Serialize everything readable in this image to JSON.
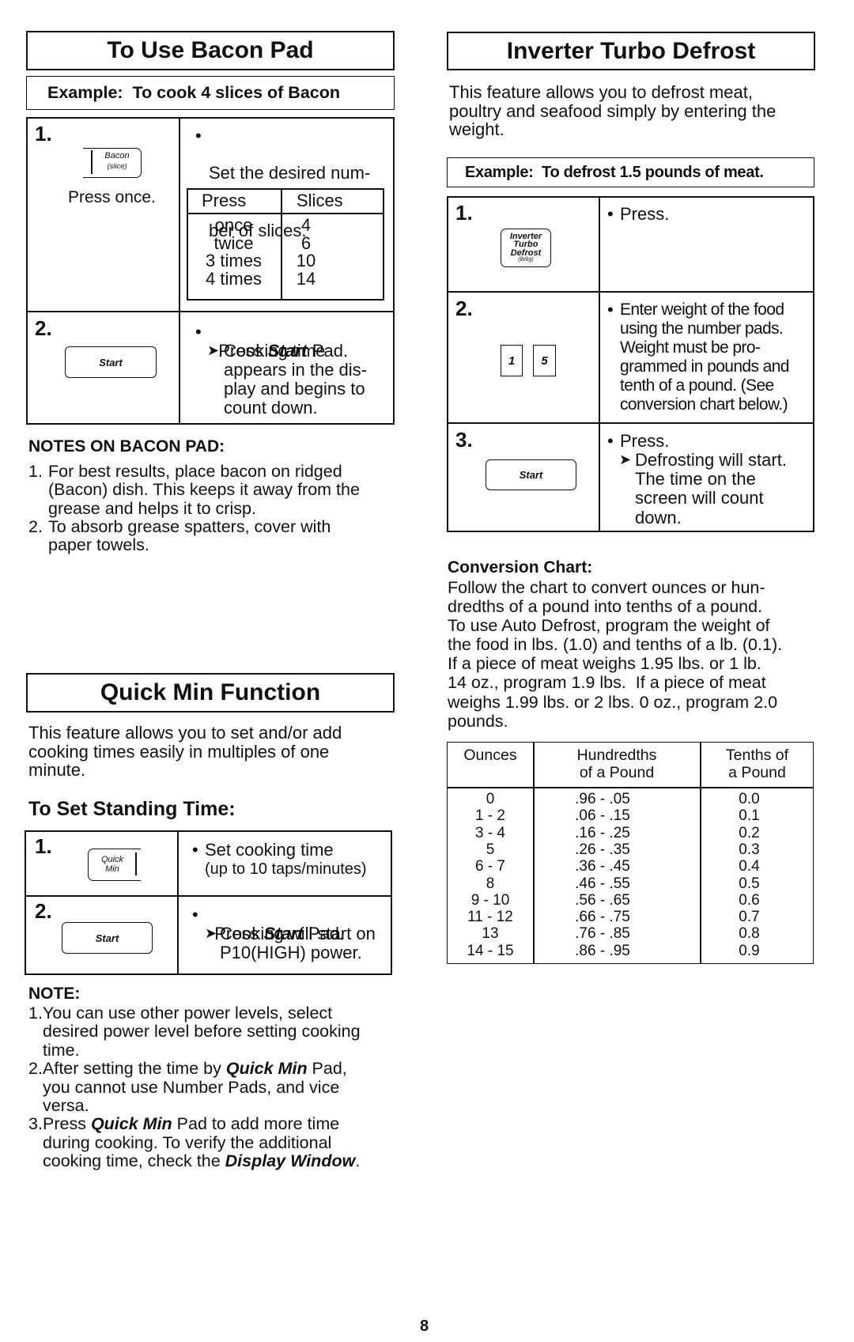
{
  "bacon": {
    "title": "To Use Bacon Pad",
    "example": "Example:  To cook 4 slices of Bacon",
    "steps": [
      {
        "number": "1.",
        "pad_label_1": "Bacon",
        "pad_label_2": "(slice)",
        "pad_caption": "Press once.",
        "instruction_line_1": "Set the desired num-",
        "instruction_line_2": "ber of slices.",
        "table": {
          "headers": [
            "Press",
            "Slices"
          ],
          "rows": [
            [
              "once",
              "4"
            ],
            [
              "twice",
              "6"
            ],
            [
              "3 times",
              "10"
            ],
            [
              "4 times",
              "14"
            ]
          ]
        }
      },
      {
        "number": "2.",
        "pad_label": "Start",
        "instruction_pre": "Press ",
        "instruction_emph": "Start",
        "instruction_post": " Pad.",
        "result_lines": [
          "Cooking time",
          "appears in the dis-",
          "play and begins to",
          "count down."
        ]
      }
    ],
    "notes_heading": "NOTES ON BACON PAD:",
    "notes": [
      {
        "num": "1.",
        "lines": [
          "For best results, place bacon on ridged",
          "(Bacon) dish. This keeps it away from the",
          "grease and helps it to crisp."
        ]
      },
      {
        "num": "2.",
        "lines": [
          "To absorb grease spatters, cover with",
          "paper towels."
        ]
      }
    ]
  },
  "quick_min": {
    "title": "Quick Min Function",
    "intro_lines": [
      "This feature allows you to set and/or add",
      "cooking times easily in multiples of one",
      "minute."
    ],
    "subheading": "To Set Standing Time:",
    "steps": [
      {
        "number": "1.",
        "pad_label_1": "Quick",
        "pad_label_2": "Min",
        "instruction_line_1": "Set cooking time",
        "instruction_line_2": "(up to 10 taps/minutes)"
      },
      {
        "number": "2.",
        "pad_label": "Start",
        "instruction_pre": "Press ",
        "instruction_emph": "Start",
        "instruction_post": " Pad.",
        "result_lines": [
          "Cooking will start on",
          "P10(HIGH) power."
        ]
      }
    ],
    "note_heading": "NOTE:",
    "notes": [
      {
        "num": "1.",
        "lines": [
          [
            "You can use other power levels, select"
          ],
          [
            "desired power level before setting cooking"
          ],
          [
            "time."
          ]
        ]
      },
      {
        "num": "2.",
        "lines": [
          [
            "After setting the time by ",
            "Quick Min",
            " Pad,"
          ],
          [
            "you cannot use Number Pads, and vice"
          ],
          [
            "versa."
          ]
        ]
      },
      {
        "num": "3.",
        "lines": [
          [
            "Press ",
            "Quick Min",
            " Pad to add more time"
          ],
          [
            "during cooking. To verify the additional"
          ],
          [
            "cooking time, check the ",
            "Display Window",
            "."
          ]
        ]
      }
    ]
  },
  "defrost": {
    "title": "Inverter Turbo Defrost",
    "intro_lines": [
      "This feature allows you to defrost meat,",
      "poultry and seafood simply by entering the",
      "weight."
    ],
    "example": "Example:  To defrost 1.5 pounds of meat.",
    "steps": [
      {
        "number": "1.",
        "pad_label_1": "Inverter",
        "pad_label_2": "Turbo",
        "pad_label_3": "Defrost",
        "pad_label_4": "(lb/kg)",
        "instruction": "Press."
      },
      {
        "number": "2.",
        "number_pads": [
          "1",
          "5"
        ],
        "instruction_lines": [
          "Enter weight of the food",
          "using the number pads.",
          "Weight must be pro-",
          "grammed in pounds and",
          "tenth of a pound. (See",
          "conversion chart below.)"
        ]
      },
      {
        "number": "3.",
        "pad_label": "Start",
        "instruction": "Press.",
        "result_lines": [
          "Defrosting will start.",
          "The time on the",
          "screen will count",
          "down."
        ]
      }
    ],
    "conversion_heading": "Conversion Chart:",
    "conversion_lines": [
      "Follow the chart to convert ounces or hun-",
      "dredths of a pound into tenths of a pound.",
      "To use Auto Defrost, program the weight of",
      "the food in lbs. (1.0) and tenths of a lb. (0.1).",
      "If a piece of meat weighs 1.95 lbs. or 1 lb.",
      "14 oz., program 1.9 lbs.  If a piece of meat",
      "weighs 1.99 lbs. or 2 lbs. 0 oz., program 2.0",
      "pounds."
    ],
    "conversion_table": {
      "headers": [
        [
          "Ounces"
        ],
        [
          "Hundredths",
          "of a Pound"
        ],
        [
          "Tenths of",
          "a Pound"
        ]
      ],
      "ounces": [
        "0",
        "1 - 2",
        "3 - 4",
        "5",
        "6 - 7",
        "8",
        "9 - 10",
        "11 - 12",
        "13",
        "14 - 15"
      ],
      "hundredths": [
        ".96 - .05",
        ".06 - .15",
        ".16 - .25",
        ".26 - .35",
        ".36 - .45",
        ".46 - .55",
        ".56 - .65",
        ".66 - .75",
        ".76 - .85",
        ".86 - .95"
      ],
      "tenths": [
        "0.0",
        "0.1",
        "0.2",
        "0.3",
        "0.4",
        "0.5",
        "0.6",
        "0.7",
        "0.8",
        "0.9"
      ]
    }
  },
  "page_number": "8",
  "glyphs": {
    "bullet": "•",
    "arrow": "➤"
  }
}
